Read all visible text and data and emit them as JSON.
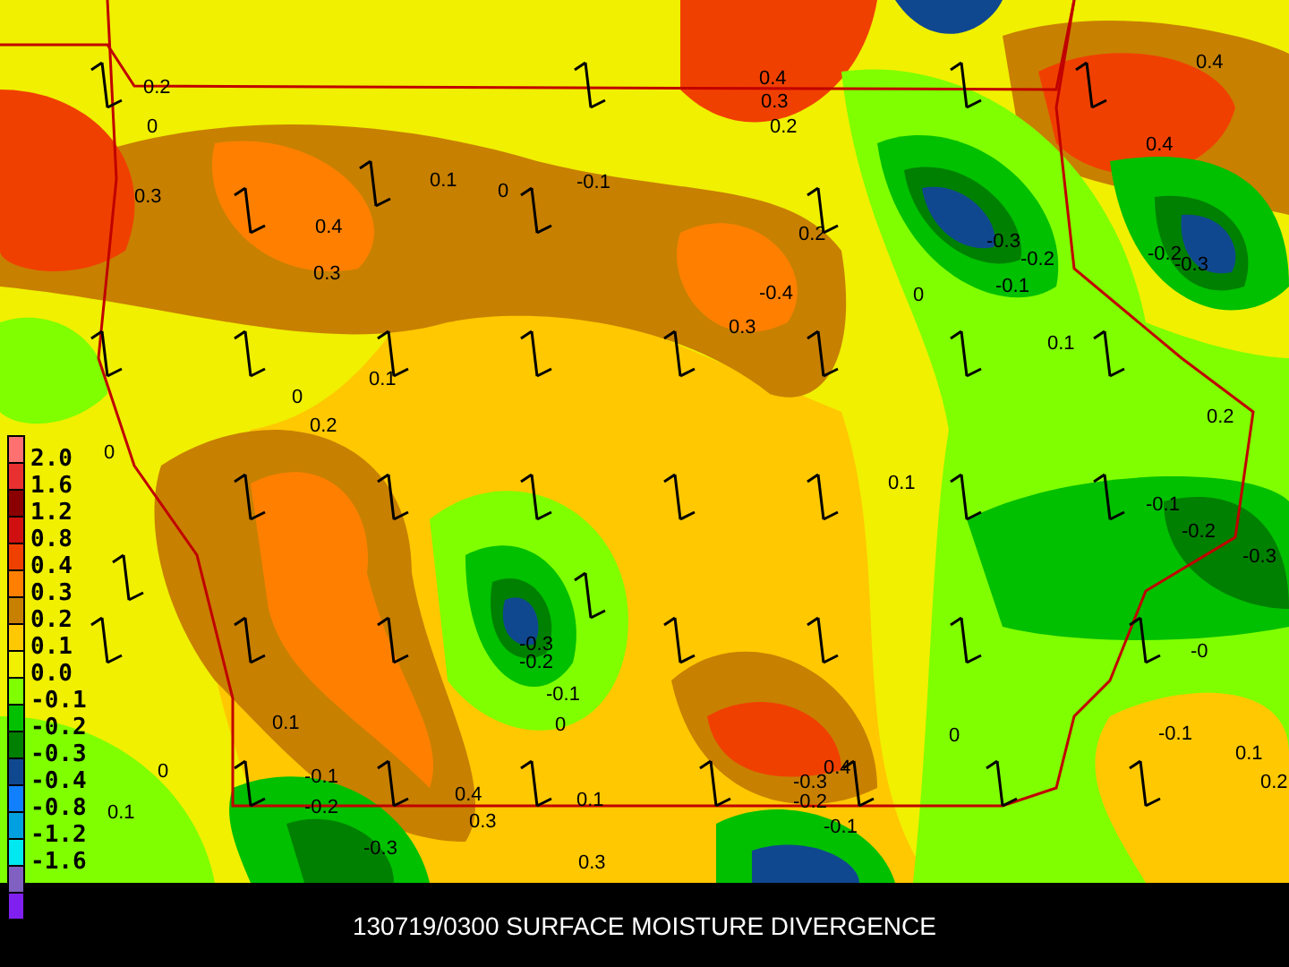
{
  "map": {
    "contour_labels": [
      "0.4",
      "0.2",
      "0.4",
      "0.3",
      "0",
      "0.2",
      "0.4",
      "0.3",
      "0.1",
      "0",
      "-0.1",
      "0.4",
      "0.2",
      "-0.3",
      "0.3",
      "-0.2",
      "-0.2",
      "-0.3",
      "-0.4",
      "0",
      "-0.1",
      "0.3",
      "0.1",
      "0.1",
      "0",
      "0.2",
      "0.2",
      "0",
      "0.1",
      "-0.1",
      "-0.2",
      "-0.3",
      "-0.3",
      "-0",
      "-0.2",
      "-0.1",
      "0.1",
      "0",
      "0",
      "-0.1",
      "0.1",
      "0",
      "-0.1",
      "-0.3",
      "0.4",
      "0.2",
      "0.1",
      "-0.2",
      "0.4",
      "0.1",
      "-0.2",
      "0.3",
      "-0.1",
      "-0.3",
      "0.3"
    ]
  },
  "legend": {
    "items": [
      {
        "label": "2.0",
        "color": "#ff7070"
      },
      {
        "label": "1.6",
        "color": "#e83030"
      },
      {
        "label": "1.2",
        "color": "#8b0000"
      },
      {
        "label": "0.8",
        "color": "#d01010"
      },
      {
        "label": "0.4",
        "color": "#f04000"
      },
      {
        "label": "0.3",
        "color": "#ff8000"
      },
      {
        "label": "0.2",
        "color": "#c88000"
      },
      {
        "label": "0.1",
        "color": "#ffc800"
      },
      {
        "label": "0.0",
        "color": "#f0f000"
      },
      {
        "label": "-0.1",
        "color": "#80ff00"
      },
      {
        "label": "-0.2",
        "color": "#00c000"
      },
      {
        "label": "-0.3",
        "color": "#008000"
      },
      {
        "label": "-0.4",
        "color": "#104890"
      },
      {
        "label": "-0.8",
        "color": "#1080ff"
      },
      {
        "label": "-1.2",
        "color": "#00a0e0"
      },
      {
        "label": "-1.6",
        "color": "#00e8f0"
      },
      {
        "color": "#8060c0"
      },
      {
        "color": "#8020f0"
      }
    ]
  },
  "caption": "130719/0300 SURFACE MOISTURE DIVERGENCE"
}
